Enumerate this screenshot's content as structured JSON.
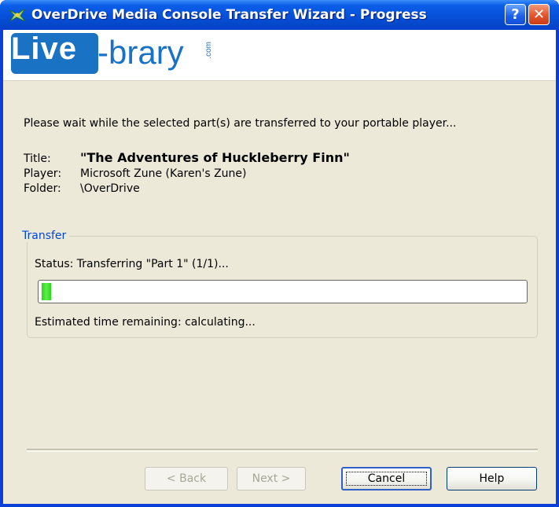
{
  "window": {
    "title": "OverDrive Media Console Transfer Wizard - Progress",
    "help_glyph": "?",
    "close_glyph": "✕"
  },
  "banner": {
    "logo_live": "Live",
    "logo_brary": "-brary",
    "logo_com": ".com"
  },
  "intro": "Please wait while the selected part(s) are transferred to your portable player...",
  "details": {
    "title_label": "Title:",
    "title_value": "\"The Adventures of Huckleberry Finn\"",
    "player_label": "Player:",
    "player_value": "Microsoft Zune (Karen's Zune)",
    "folder_label": "Folder:",
    "folder_value": "\\OverDrive"
  },
  "transfer": {
    "group_label": "Transfer",
    "status": "Status: Transferring \"Part 1\" (1/1)...",
    "progress_fraction": 0.02,
    "estimate": "Estimated time remaining: calculating..."
  },
  "buttons": {
    "back": "< Back",
    "next": "Next >",
    "cancel": "Cancel",
    "help": "Help"
  },
  "icons": {
    "title_icon": "overdrive-icon",
    "help_icon": "help-icon",
    "close_icon": "close-icon"
  },
  "colors": {
    "titlebar": "#0650d9",
    "client_bg": "#ece9d8",
    "accent": "#0046d5",
    "progress_fill": "#2cd41c",
    "logo_blue": "#1a72c4"
  }
}
